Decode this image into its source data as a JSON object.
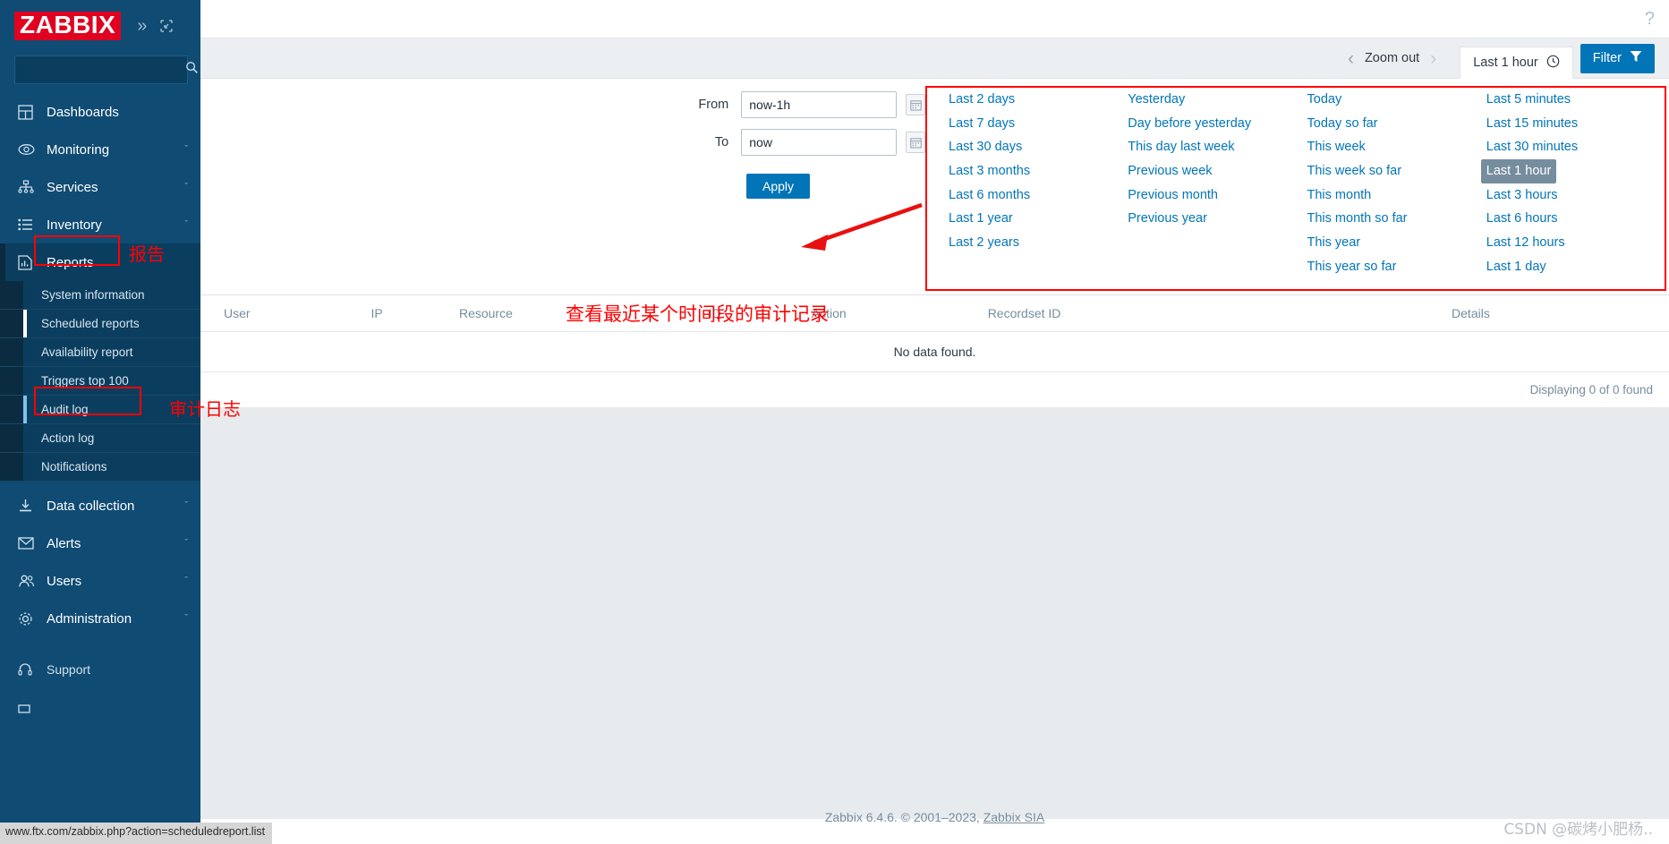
{
  "brand": {
    "logo_text": "ZABBIX",
    "collapse_icon": "chevrons-right-icon",
    "kiosk_icon": "kiosk-mode-icon"
  },
  "search": {
    "placeholder": "",
    "value": "",
    "icon": "search-icon"
  },
  "sidebar": {
    "items": [
      {
        "label": "Dashboards",
        "icon": "dashboard-grid-icon",
        "arrow": ""
      },
      {
        "label": "Monitoring",
        "icon": "eye-icon",
        "arrow": "ˇ"
      },
      {
        "label": "Services",
        "icon": "sitemap-icon",
        "arrow": "ˇ"
      },
      {
        "label": "Inventory",
        "icon": "list-icon",
        "arrow": "ˇ"
      },
      {
        "label": "Reports",
        "icon": "report-chart-icon",
        "arrow": ""
      },
      {
        "label": "Data collection",
        "icon": "download-icon",
        "arrow": "ˇ"
      },
      {
        "label": "Alerts",
        "icon": "envelope-icon",
        "arrow": "ˇ"
      },
      {
        "label": "Users",
        "icon": "users-icon",
        "arrow": "ˇ"
      },
      {
        "label": "Administration",
        "icon": "gear-icon",
        "arrow": "ˇ"
      }
    ],
    "reports_submenu": [
      {
        "label": "System information"
      },
      {
        "label": "Scheduled reports"
      },
      {
        "label": "Availability report"
      },
      {
        "label": "Triggers top 100"
      },
      {
        "label": "Audit log"
      },
      {
        "label": "Action log"
      },
      {
        "label": "Notifications"
      }
    ],
    "support_label": "Support"
  },
  "annotations": {
    "reports_cn": "报告",
    "auditlog_cn": "审计日志",
    "timerange_cn": "查看最近某个时间段的审计记录"
  },
  "topbar": {
    "help_icon": "question-mark-icon"
  },
  "timebar": {
    "prev_icon": "chevron-left-icon",
    "next_icon": "chevron-right-icon",
    "zoom_out_label": "Zoom out",
    "range_tab_label": "Last 1 hour",
    "clock_icon": "clock-icon",
    "filter_label": "Filter",
    "filter_icon": "funnel-icon"
  },
  "time_panel": {
    "from_label": "From",
    "from_value": "now-1h",
    "to_label": "To",
    "to_value": "now",
    "apply_label": "Apply",
    "calendar_icon": "calendar-icon",
    "columns": [
      [
        "Last 2 days",
        "Last 7 days",
        "Last 30 days",
        "Last 3 months",
        "Last 6 months",
        "Last 1 year",
        "Last 2 years"
      ],
      [
        "Yesterday",
        "Day before yesterday",
        "This day last week",
        "Previous week",
        "Previous month",
        "Previous year"
      ],
      [
        "Today",
        "Today so far",
        "This week",
        "This week so far",
        "This month",
        "This month so far",
        "This year",
        "This year so far"
      ],
      [
        "Last 5 minutes",
        "Last 15 minutes",
        "Last 30 minutes",
        "Last 1 hour",
        "Last 3 hours",
        "Last 6 hours",
        "Last 12 hours",
        "Last 1 day"
      ]
    ],
    "selected": "Last 1 hour"
  },
  "table": {
    "headers": [
      "User",
      "IP",
      "Resource",
      "ID",
      "Action",
      "Recordset ID",
      "Details"
    ],
    "empty_text": "No data found.",
    "displaying_text": "Displaying 0 of 0 found"
  },
  "footer": {
    "text": "Zabbix 6.4.6. © 2001–2023, ",
    "link": "Zabbix SIA"
  },
  "status_url": "www.ftx.com/zabbix.php?action=scheduledreport.list",
  "watermark": "CSDN @碳烤小肥杨..",
  "colors": {
    "brand_red": "#e00020",
    "sidebar_blue": "#0f4b73",
    "accent_blue": "#0275b8",
    "link_blue": "#0275b8",
    "annotation_red": "#ff0000"
  }
}
